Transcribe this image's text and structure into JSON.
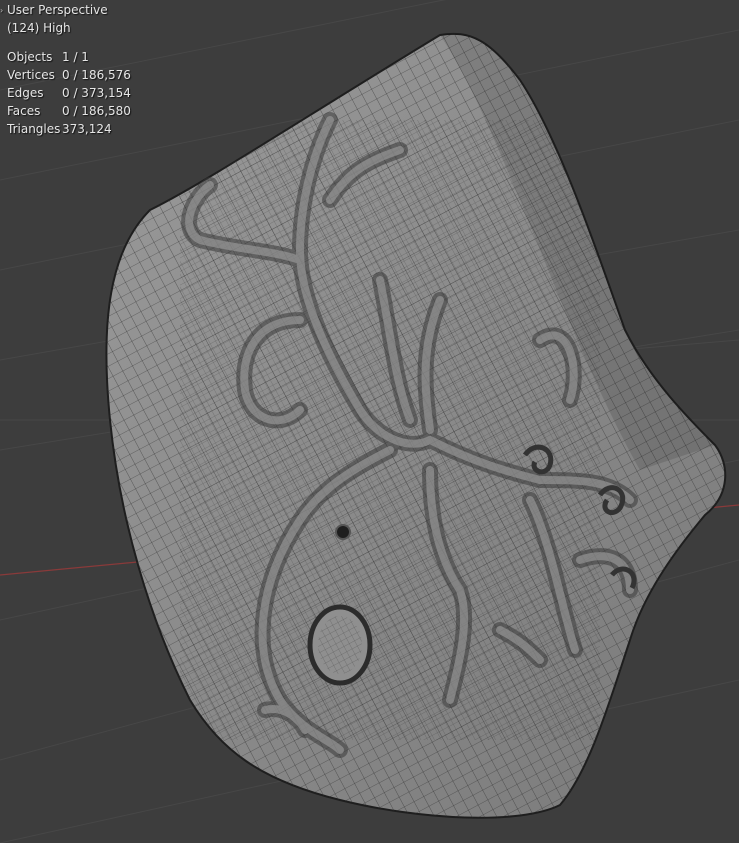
{
  "viewport": {
    "view_name": "User Perspective",
    "collection_info": "(124) High",
    "background_color": "#3d3d3d",
    "grid_color": "#474747",
    "x_axis_color": "#8a3a3a",
    "mesh_color": "#8c8c8c",
    "wire_color": "#2a2a2a"
  },
  "stats": [
    {
      "label": "Objects",
      "value": "1 / 1"
    },
    {
      "label": "Vertices",
      "value": "0 / 186,576"
    },
    {
      "label": "Edges",
      "value": "0 / 373,154"
    },
    {
      "label": "Faces",
      "value": "0 / 186,580"
    },
    {
      "label": "Triangles",
      "value": "373,124"
    }
  ],
  "icons": {
    "corner": "chevron-right-icon"
  }
}
